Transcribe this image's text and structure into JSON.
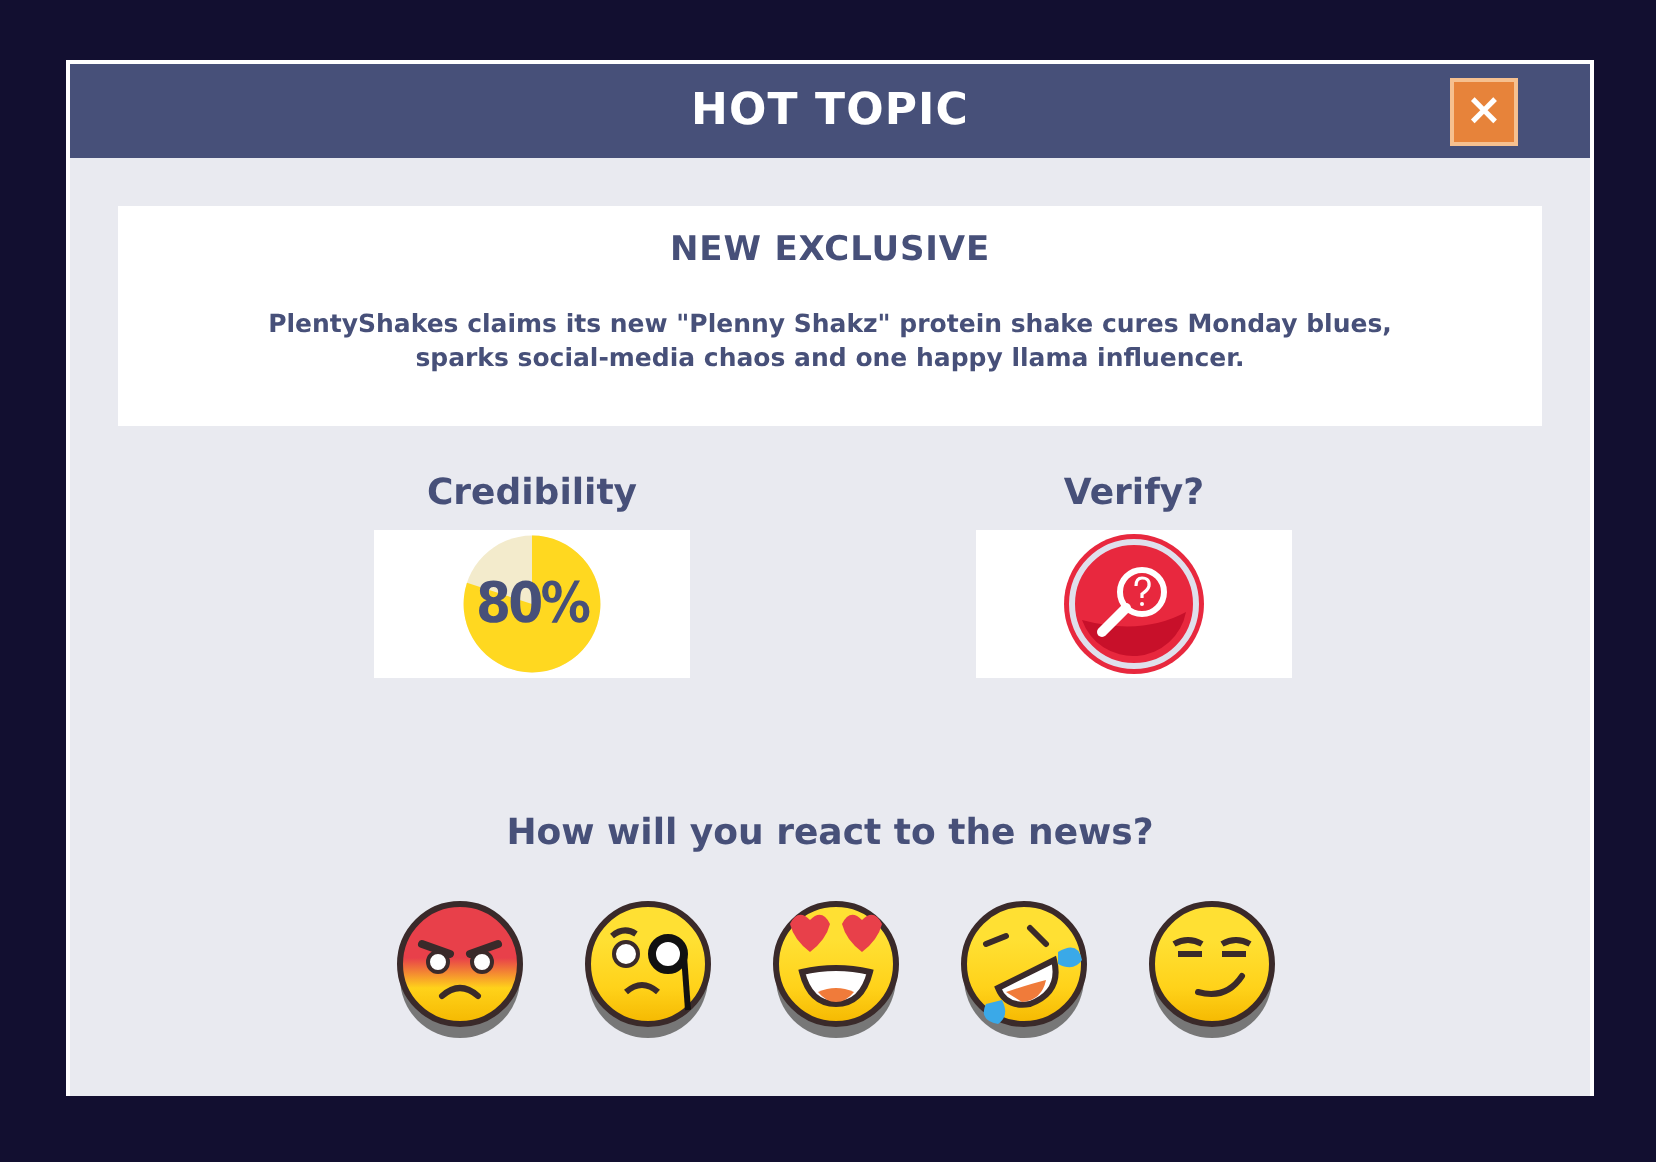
{
  "dialog": {
    "title": "HOT TOPIC",
    "close": "×"
  },
  "news": {
    "heading": "NEW EXCLUSIVE",
    "body": "PlentyShakes claims its new \"Plenny Shakz\" protein shake cures Monday blues, sparks social-media chaos and one happy llama influencer."
  },
  "credibility": {
    "label": "Credibility",
    "reading": "80%"
  },
  "verify": {
    "label": "Verify?"
  },
  "question": "How will you react to the news?",
  "reactions": [
    {
      "kind": "angry"
    },
    {
      "kind": "monocle"
    },
    {
      "kind": "hearts"
    },
    {
      "kind": "laughing"
    },
    {
      "kind": "smirk"
    }
  ]
}
